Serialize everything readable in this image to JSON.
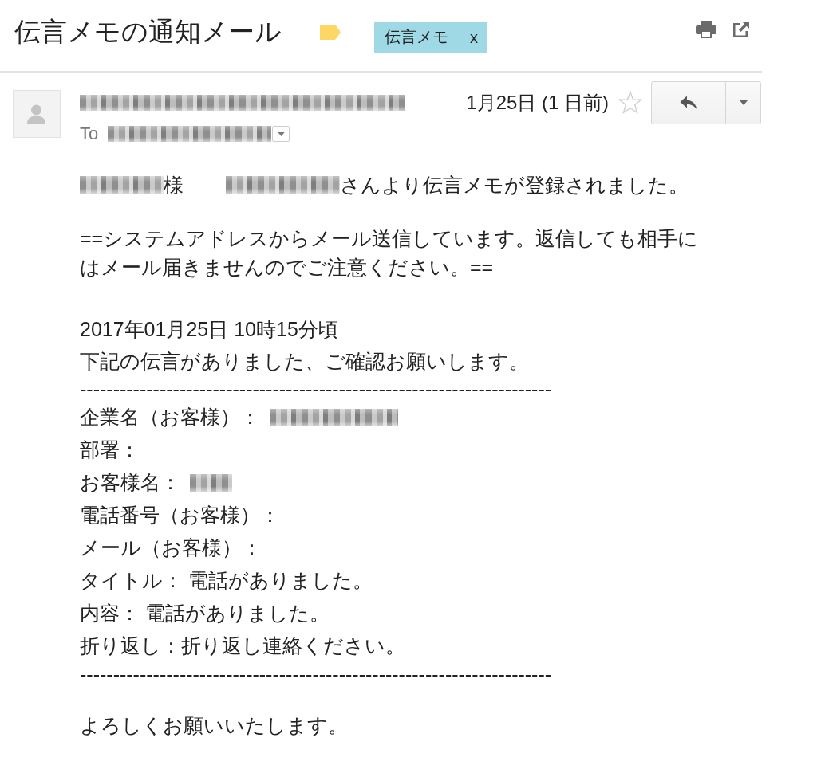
{
  "thread": {
    "subject": "伝言メモの通知メール",
    "important": true,
    "labels": [
      {
        "name": "伝言メモ",
        "remove": "x",
        "color": "#9fd9e5"
      }
    ]
  },
  "message": {
    "sender_redacted": true,
    "date": "1月25日 (1 日前)",
    "starred": false,
    "to_label": "To",
    "recipient_redacted": true
  },
  "body": {
    "greeting": {
      "recipient_redacted": true,
      "honorific": "様",
      "sender_redacted": true,
      "text": "さんより伝言メモが登録されました。"
    },
    "notice_lines": [
      "==システムアドレスからメール送信しています。返信しても相手に",
      "はメール届きませんのでご注意ください。=="
    ],
    "received_at": "2017年01月25日 10時15分頃",
    "request": "下記の伝言がありました、ご確認お願いします。",
    "rule_top": "-----------------------------------------------------------------------",
    "fields": [
      {
        "text": "企業名（お客様）：",
        "value_redacted": true
      },
      {
        "text": "部署：",
        "value_redacted": false
      },
      {
        "text": "お客様名：",
        "value_redacted": true
      },
      {
        "text": "電話番号（お客様）：",
        "value_redacted": false
      },
      {
        "text": "メール（お客様）：",
        "value_redacted": false
      },
      {
        "text": "タイトル： 電話がありました。",
        "value_redacted": false
      },
      {
        "text": "内容： 電話がありました。",
        "value_redacted": false
      },
      {
        "text": "折り返し：折り返し連絡ください。",
        "value_redacted": false
      }
    ],
    "rule_bottom": "-----------------------------------------------------------------------",
    "closing": "よろしくお願いいたします。"
  }
}
